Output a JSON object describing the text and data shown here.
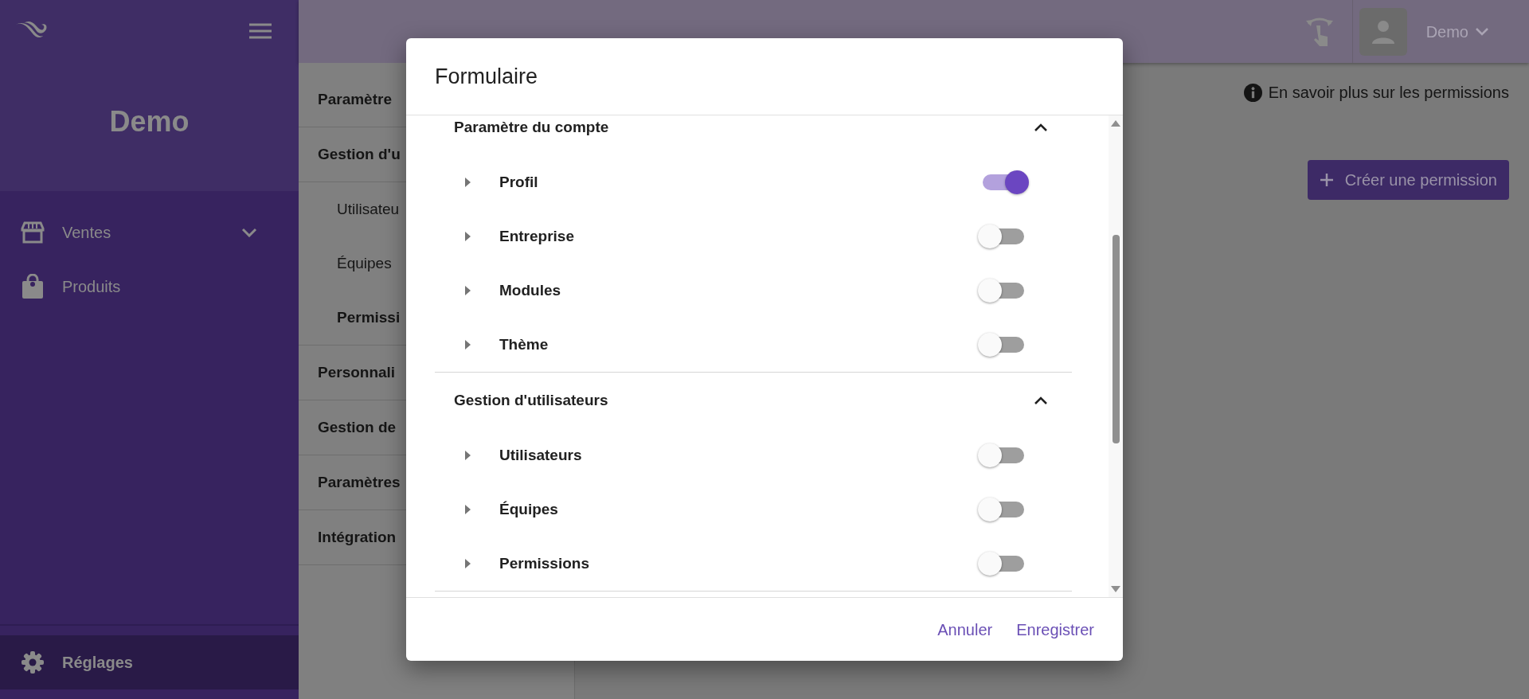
{
  "sidebar": {
    "title": "Demo",
    "items": [
      {
        "label": "Ventes",
        "kind": "group",
        "selected": false
      },
      {
        "label": "Produits",
        "kind": "link",
        "selected": false
      }
    ],
    "footer_item": {
      "label": "Réglages",
      "selected": true
    }
  },
  "topbar": {
    "user": "Demo"
  },
  "settings_menu": [
    {
      "label": "Paramètre"
    },
    {
      "label": "Gestion d'u",
      "children": [
        {
          "label": "Utilisateu",
          "selected": false
        },
        {
          "label": "Équipes",
          "selected": false
        },
        {
          "label": "Permissi",
          "selected": true
        }
      ]
    },
    {
      "label": "Personnali"
    },
    {
      "label": "Gestion de"
    },
    {
      "label": "Paramètres"
    },
    {
      "label": "Intégration"
    }
  ],
  "info_link": "En savoir plus sur les permissions",
  "create_button": "Créer une permission",
  "modal": {
    "title": "Formulaire",
    "sections": [
      {
        "title": "Paramètre du compte",
        "expanded": true,
        "items": [
          {
            "label": "Profil",
            "on": true
          },
          {
            "label": "Entreprise",
            "on": false
          },
          {
            "label": "Modules",
            "on": false
          },
          {
            "label": "Thème",
            "on": false
          }
        ]
      },
      {
        "title": "Gestion d'utilisateurs",
        "expanded": true,
        "items": [
          {
            "label": "Utilisateurs",
            "on": false
          },
          {
            "label": "Équipes",
            "on": false
          },
          {
            "label": "Permissions",
            "on": false
          }
        ]
      }
    ],
    "buttons": [
      "Annuler",
      "Enregistrer"
    ]
  }
}
